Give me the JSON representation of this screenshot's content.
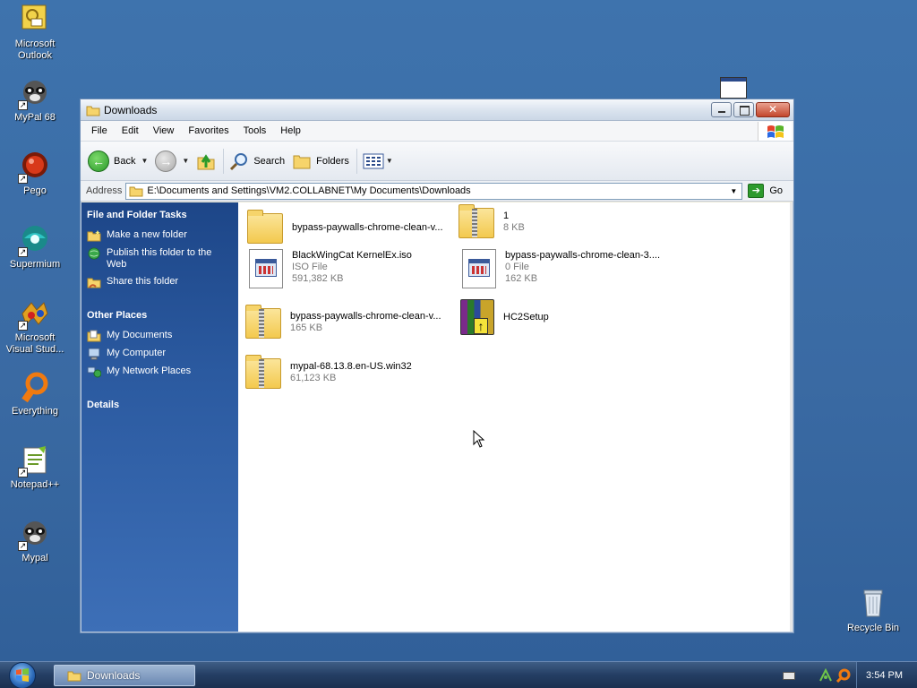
{
  "desktop": {
    "icons": [
      {
        "label": "Microsoft Outlook"
      },
      {
        "label": "MyPal 68"
      },
      {
        "label": "Pego"
      },
      {
        "label": "Supermium"
      },
      {
        "label": "Microsoft Visual Stud..."
      },
      {
        "label": "Everything"
      },
      {
        "label": "Notepad++"
      },
      {
        "label": "Mypal"
      }
    ],
    "recycle_bin": {
      "label": "Recycle Bin"
    }
  },
  "window": {
    "title": "Downloads",
    "menu": [
      "File",
      "Edit",
      "View",
      "Favorites",
      "Tools",
      "Help"
    ],
    "toolbar": {
      "back_label": "Back",
      "search_label": "Search",
      "folders_label": "Folders"
    },
    "address": {
      "label": "Address",
      "path": "E:\\Documents and Settings\\VM2.COLLABNET\\My Documents\\Downloads",
      "go_label": "Go"
    },
    "taskpane": {
      "file_tasks_heading": "File and Folder Tasks",
      "file_tasks": [
        {
          "label": "Make a new folder"
        },
        {
          "label": "Publish this folder to the Web"
        },
        {
          "label": "Share this folder"
        }
      ],
      "other_places_heading": "Other Places",
      "other_places": [
        {
          "label": "My Documents"
        },
        {
          "label": "My Computer"
        },
        {
          "label": "My Network Places"
        }
      ],
      "details_heading": "Details"
    },
    "files": [
      {
        "name": "bypass-paywalls-chrome-clean-v...",
        "type": "",
        "size": "",
        "icon": "folder-icon"
      },
      {
        "name": "1",
        "type": "",
        "size": "8 KB",
        "icon": "zip-folder-icon"
      },
      {
        "name": "BlackWingCat KernelEx.iso",
        "type": "ISO File",
        "size": "591,382 KB",
        "icon": "file-icon"
      },
      {
        "name": "bypass-paywalls-chrome-clean-3....",
        "type": "0 File",
        "size": "162 KB",
        "icon": "file-icon"
      },
      {
        "name": "bypass-paywalls-chrome-clean-v...",
        "type": "",
        "size": "165 KB",
        "icon": "zip-folder-icon"
      },
      {
        "name": "HC2Setup",
        "type": "",
        "size": "",
        "icon": "installer-icon"
      },
      {
        "name": "mypal-68.13.8.en-US.win32",
        "type": "",
        "size": "61,123 KB",
        "icon": "zip-folder-icon"
      }
    ]
  },
  "taskbar": {
    "active_window_label": "Downloads",
    "clock": "3:54 PM"
  }
}
